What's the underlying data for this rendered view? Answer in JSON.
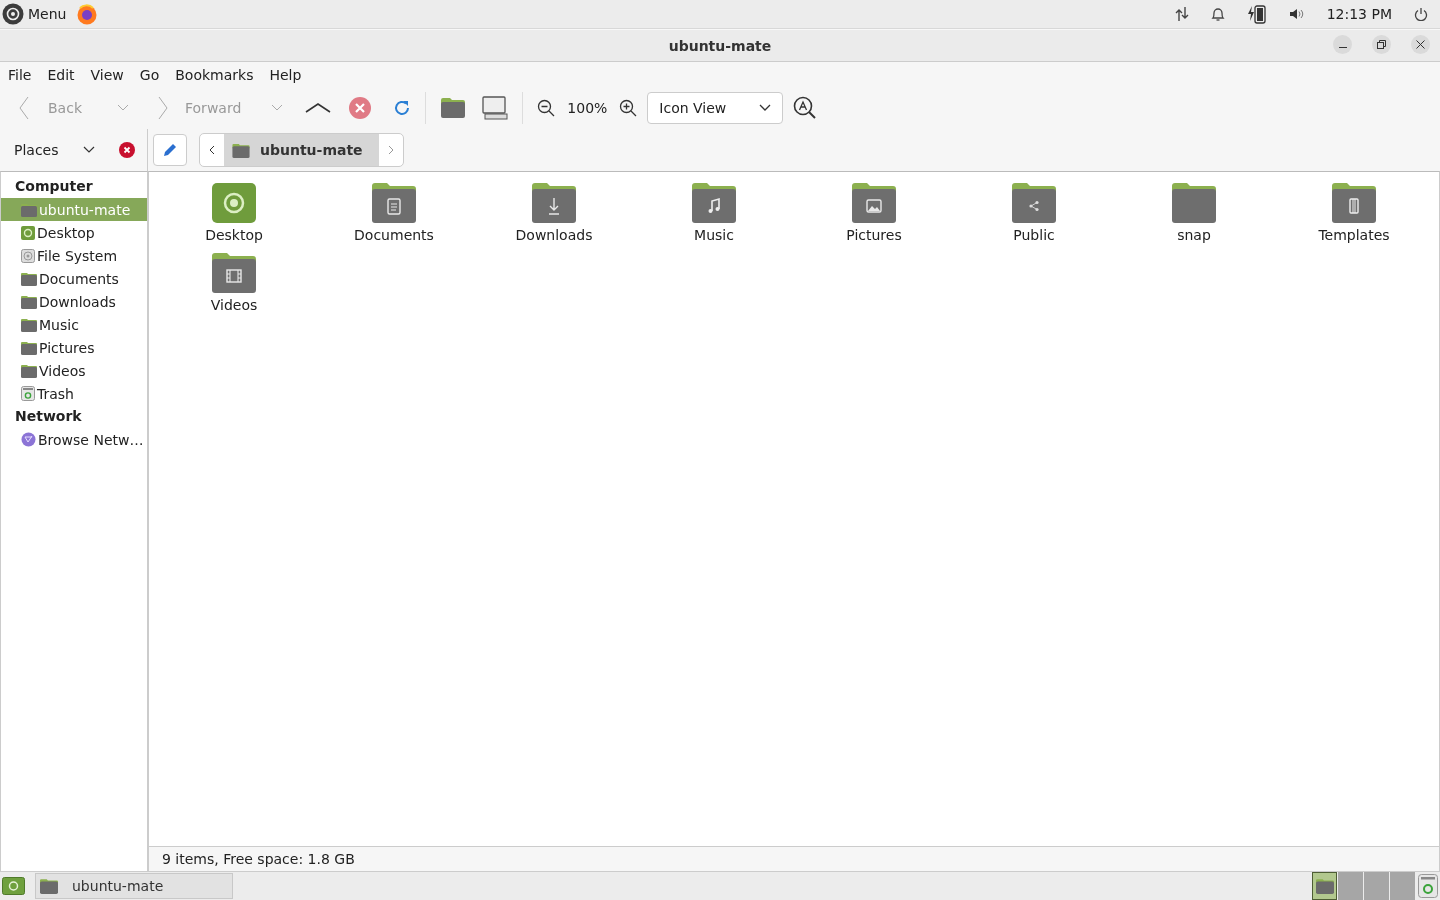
{
  "top_panel": {
    "menu_label": "Menu",
    "clock": "12:13 PM"
  },
  "window": {
    "title": "ubuntu-mate"
  },
  "menu_bar": [
    "File",
    "Edit",
    "View",
    "Go",
    "Bookmarks",
    "Help"
  ],
  "toolbar": {
    "back": {
      "label": "Back",
      "disabled": true
    },
    "forward": {
      "label": "Forward",
      "disabled": true
    },
    "zoom": "100%",
    "view_mode": "Icon View"
  },
  "location_bar": {
    "pane": "Places",
    "path": [
      {
        "label": "ubuntu-mate",
        "selected": true
      }
    ]
  },
  "sidebar": [
    {
      "heading": "Computer",
      "items": [
        {
          "label": "ubuntu-mate",
          "kind": "folder",
          "selected": true
        },
        {
          "label": "Desktop",
          "kind": "desktop",
          "selected": false
        },
        {
          "label": "File System",
          "kind": "disk",
          "selected": false
        },
        {
          "label": "Documents",
          "kind": "folder",
          "selected": false
        },
        {
          "label": "Downloads",
          "kind": "folder",
          "selected": false
        },
        {
          "label": "Music",
          "kind": "folder",
          "selected": false
        },
        {
          "label": "Pictures",
          "kind": "folder",
          "selected": false
        },
        {
          "label": "Videos",
          "kind": "folder",
          "selected": false
        },
        {
          "label": "Trash",
          "kind": "trash",
          "selected": false
        }
      ]
    },
    {
      "heading": "Network",
      "items": [
        {
          "label": "Browse Netw…",
          "kind": "network",
          "selected": false
        }
      ]
    }
  ],
  "files": [
    {
      "name": "Desktop",
      "kind": "desktop"
    },
    {
      "name": "Documents",
      "kind": "documents"
    },
    {
      "name": "Downloads",
      "kind": "downloads"
    },
    {
      "name": "Music",
      "kind": "music"
    },
    {
      "name": "Pictures",
      "kind": "pictures"
    },
    {
      "name": "Public",
      "kind": "public"
    },
    {
      "name": "snap",
      "kind": "plain"
    },
    {
      "name": "Templates",
      "kind": "templates"
    },
    {
      "name": "Videos",
      "kind": "videos"
    }
  ],
  "status_bar": "9 items, Free space: 1.8 GB",
  "taskbar": {
    "windows": [
      {
        "label": "ubuntu-mate"
      }
    ],
    "workspaces": [
      {
        "selected": true
      },
      {
        "selected": false
      },
      {
        "selected": false
      },
      {
        "selected": false
      }
    ]
  }
}
